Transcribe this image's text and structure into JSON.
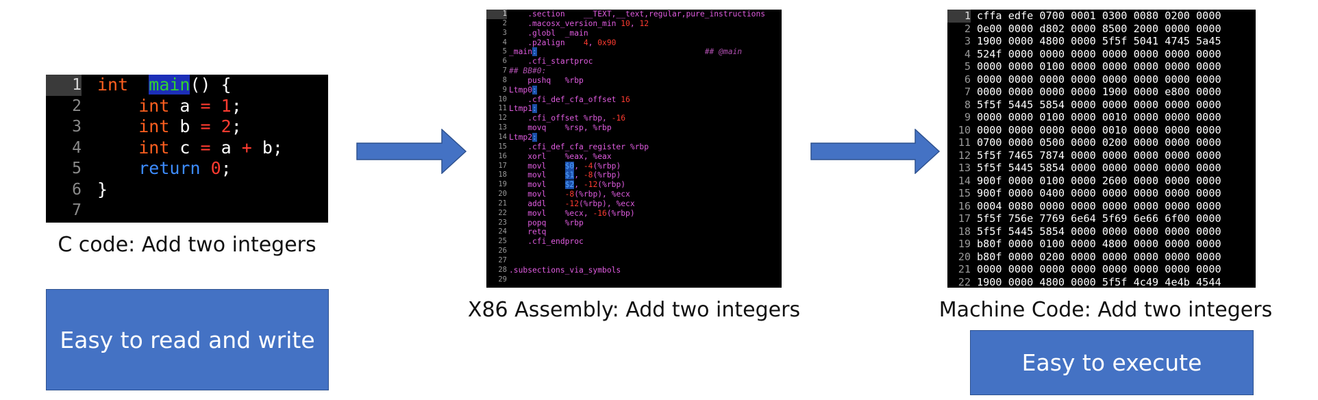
{
  "c_code": {
    "caption": "C code: Add two integers",
    "lines": [
      {
        "n": "1",
        "parts": [
          [
            "kw",
            "int"
          ],
          [
            "",
            "  "
          ],
          [
            "fn",
            "main"
          ],
          [
            "",
            "() {"
          ]
        ]
      },
      {
        "n": "2",
        "parts": [
          [
            "",
            "    "
          ],
          [
            "kw",
            "int"
          ],
          [
            "",
            " a "
          ],
          [
            "op",
            "="
          ],
          [
            "",
            " "
          ],
          [
            "num",
            "1"
          ],
          [
            "",
            ";"
          ]
        ]
      },
      {
        "n": "3",
        "parts": [
          [
            "",
            "    "
          ],
          [
            "kw",
            "int"
          ],
          [
            "",
            " b "
          ],
          [
            "op",
            "="
          ],
          [
            "",
            " "
          ],
          [
            "num",
            "2"
          ],
          [
            "",
            ";"
          ]
        ]
      },
      {
        "n": "4",
        "parts": [
          [
            "",
            "    "
          ],
          [
            "kw",
            "int"
          ],
          [
            "",
            " c "
          ],
          [
            "op",
            "="
          ],
          [
            "",
            " a "
          ],
          [
            "op",
            "+"
          ],
          [
            "",
            " b;"
          ]
        ]
      },
      {
        "n": "5",
        "parts": [
          [
            "",
            "    "
          ],
          [
            "ret",
            "return"
          ],
          [
            "",
            " "
          ],
          [
            "num",
            "0"
          ],
          [
            "",
            ";"
          ]
        ]
      },
      {
        "n": "6",
        "parts": [
          [
            "",
            "}"
          ]
        ]
      },
      {
        "n": "7",
        "parts": []
      }
    ]
  },
  "assembly": {
    "caption": "X86 Assembly: Add two integers",
    "lines": [
      {
        "n": "1",
        "parts": [
          [
            "",
            "    .section    __TEXT,__text,regular,pure_instructions"
          ]
        ]
      },
      {
        "n": "2",
        "parts": [
          [
            "",
            "    .macosx_version_min "
          ],
          [
            "a-num",
            "10"
          ],
          [
            "",
            ", "
          ],
          [
            "a-num",
            "12"
          ]
        ]
      },
      {
        "n": "3",
        "parts": [
          [
            "",
            "    .globl  _main"
          ]
        ]
      },
      {
        "n": "4",
        "parts": [
          [
            "",
            "    .p2align    "
          ],
          [
            "a-num",
            "4"
          ],
          [
            "",
            ", "
          ],
          [
            "a-num",
            "0x90"
          ]
        ]
      },
      {
        "n": "5",
        "parts": [
          [
            "",
            "_main"
          ],
          [
            "a-hl",
            ":"
          ],
          [
            "",
            "                                    "
          ],
          [
            "a-cmt",
            "## @main"
          ]
        ]
      },
      {
        "n": "6",
        "parts": [
          [
            "",
            "    .cfi_startproc"
          ]
        ]
      },
      {
        "n": "7",
        "parts": [
          [
            "a-cmt",
            "## BB#0:"
          ]
        ]
      },
      {
        "n": "8",
        "parts": [
          [
            "",
            "    pushq   %rbp"
          ]
        ]
      },
      {
        "n": "9",
        "parts": [
          [
            "",
            "Ltmp0"
          ],
          [
            "a-hl",
            ":"
          ]
        ]
      },
      {
        "n": "10",
        "parts": [
          [
            "",
            "    .cfi_def_cfa_offset "
          ],
          [
            "a-num",
            "16"
          ]
        ]
      },
      {
        "n": "11",
        "parts": [
          [
            "",
            "Ltmp1"
          ],
          [
            "a-hl",
            ":"
          ]
        ]
      },
      {
        "n": "12",
        "parts": [
          [
            "",
            "    .cfi_offset %rbp, "
          ],
          [
            "a-num",
            "-16"
          ]
        ]
      },
      {
        "n": "13",
        "parts": [
          [
            "",
            "    movq    %rsp, %rbp"
          ]
        ]
      },
      {
        "n": "14",
        "parts": [
          [
            "",
            "Ltmp2"
          ],
          [
            "a-hl",
            ":"
          ]
        ]
      },
      {
        "n": "15",
        "parts": [
          [
            "",
            "    .cfi_def_cfa_register %rbp"
          ]
        ]
      },
      {
        "n": "16",
        "parts": [
          [
            "",
            "    xorl    %eax, %eax"
          ]
        ]
      },
      {
        "n": "17",
        "parts": [
          [
            "",
            "    movl    "
          ],
          [
            "a-hl",
            "$0"
          ],
          [
            "",
            ", "
          ],
          [
            "a-num",
            "-4"
          ],
          [
            "",
            "(%rbp)"
          ]
        ]
      },
      {
        "n": "18",
        "parts": [
          [
            "",
            "    movl    "
          ],
          [
            "a-hl",
            "$1"
          ],
          [
            "",
            ", "
          ],
          [
            "a-num",
            "-8"
          ],
          [
            "",
            "(%rbp)"
          ]
        ]
      },
      {
        "n": "19",
        "parts": [
          [
            "",
            "    movl    "
          ],
          [
            "a-hl",
            "$2"
          ],
          [
            "",
            ", "
          ],
          [
            "a-num",
            "-12"
          ],
          [
            "",
            "(%rbp)"
          ]
        ]
      },
      {
        "n": "20",
        "parts": [
          [
            "",
            "    movl    "
          ],
          [
            "a-num",
            "-8"
          ],
          [
            "",
            "(%rbp), %ecx"
          ]
        ]
      },
      {
        "n": "21",
        "parts": [
          [
            "",
            "    addl    "
          ],
          [
            "a-num",
            "-12"
          ],
          [
            "",
            "(%rbp), %ecx"
          ]
        ]
      },
      {
        "n": "22",
        "parts": [
          [
            "",
            "    movl    %ecx, "
          ],
          [
            "a-num",
            "-16"
          ],
          [
            "",
            "(%rbp)"
          ]
        ]
      },
      {
        "n": "23",
        "parts": [
          [
            "",
            "    popq    %rbp"
          ]
        ]
      },
      {
        "n": "24",
        "parts": [
          [
            "",
            "    retq"
          ]
        ]
      },
      {
        "n": "25",
        "parts": [
          [
            "",
            "    .cfi_endproc"
          ]
        ]
      },
      {
        "n": "26",
        "parts": []
      },
      {
        "n": "27",
        "parts": []
      },
      {
        "n": "28",
        "parts": [
          [
            "",
            ".subsections_via_symbols"
          ]
        ]
      },
      {
        "n": "29",
        "parts": []
      }
    ]
  },
  "machine_code": {
    "caption": "Machine Code: Add two integers",
    "lines": [
      {
        "n": "1",
        "text": "cffa edfe 0700 0001 0300 0080 0200 0000"
      },
      {
        "n": "2",
        "text": "0e00 0000 d802 0000 8500 2000 0000 0000"
      },
      {
        "n": "3",
        "text": "1900 0000 4800 0000 5f5f 5041 4745 5a45"
      },
      {
        "n": "4",
        "text": "524f 0000 0000 0000 0000 0000 0000 0000"
      },
      {
        "n": "5",
        "text": "0000 0000 0100 0000 0000 0000 0000 0000"
      },
      {
        "n": "6",
        "text": "0000 0000 0000 0000 0000 0000 0000 0000"
      },
      {
        "n": "7",
        "text": "0000 0000 0000 0000 1900 0000 e800 0000"
      },
      {
        "n": "8",
        "text": "5f5f 5445 5854 0000 0000 0000 0000 0000"
      },
      {
        "n": "9",
        "text": "0000 0000 0100 0000 0010 0000 0000 0000"
      },
      {
        "n": "10",
        "text": "0000 0000 0000 0000 0010 0000 0000 0000"
      },
      {
        "n": "11",
        "text": "0700 0000 0500 0000 0200 0000 0000 0000"
      },
      {
        "n": "12",
        "text": "5f5f 7465 7874 0000 0000 0000 0000 0000"
      },
      {
        "n": "13",
        "text": "5f5f 5445 5854 0000 0000 0000 0000 0000"
      },
      {
        "n": "14",
        "text": "900f 0000 0100 0000 2600 0000 0000 0000"
      },
      {
        "n": "15",
        "text": "900f 0000 0400 0000 0000 0000 0000 0000"
      },
      {
        "n": "16",
        "text": "0004 0080 0000 0000 0000 0000 0000 0000"
      },
      {
        "n": "17",
        "text": "5f5f 756e 7769 6e64 5f69 6e66 6f00 0000"
      },
      {
        "n": "18",
        "text": "5f5f 5445 5854 0000 0000 0000 0000 0000"
      },
      {
        "n": "19",
        "text": "b80f 0000 0100 0000 4800 0000 0000 0000"
      },
      {
        "n": "20",
        "text": "b80f 0000 0200 0000 0000 0000 0000 0000"
      },
      {
        "n": "21",
        "text": "0000 0000 0000 0000 0000 0000 0000 0000"
      },
      {
        "n": "22",
        "text": "1900 0000 4800 0000 5f5f 4c49 4e4b 4544"
      }
    ]
  },
  "boxes": {
    "read_write": "Easy to read and write",
    "execute": "Easy to execute"
  },
  "colors": {
    "box_fill": "#4472c4",
    "arrow_fill": "#4472c4",
    "keyword": "#ff5f1f",
    "function_name": "#31d131",
    "number": "#ff3b30",
    "return_keyword": "#3d8cff",
    "asm_text": "#e05ce0"
  }
}
